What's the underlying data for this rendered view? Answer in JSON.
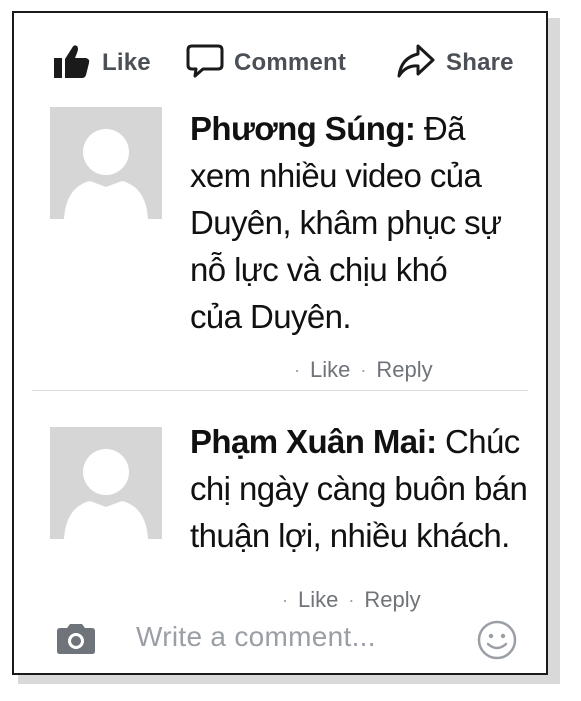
{
  "actions": {
    "like_label": "Like",
    "comment_label": "Comment",
    "share_label": "Share"
  },
  "comments": [
    {
      "author": "Phương Súng:",
      "text_lines": [
        " Đã",
        "xem nhiều video của",
        "Duyên, khâm phục sự",
        "nỗ lực và chịu khó",
        "của Duyên."
      ],
      "like_label": "Like",
      "reply_label": "Reply"
    },
    {
      "author": "Phạm Xuân Mai:",
      "text_lines": [
        " Chúc",
        "chị ngày càng buôn bán",
        "thuận lợi, nhiều khách."
      ],
      "like_label": "Like",
      "reply_label": "Reply"
    }
  ],
  "composer": {
    "placeholder": "Write a comment..."
  },
  "icons": [
    "thumbs-up-icon",
    "comment-bubble-icon",
    "share-arrow-icon",
    "camera-icon",
    "smiley-icon"
  ],
  "colors": {
    "action_text": "#4b4f56",
    "meta_text": "#6f737a",
    "placeholder": "#9a9ea5",
    "avatar_bg": "#d6d6d6"
  }
}
